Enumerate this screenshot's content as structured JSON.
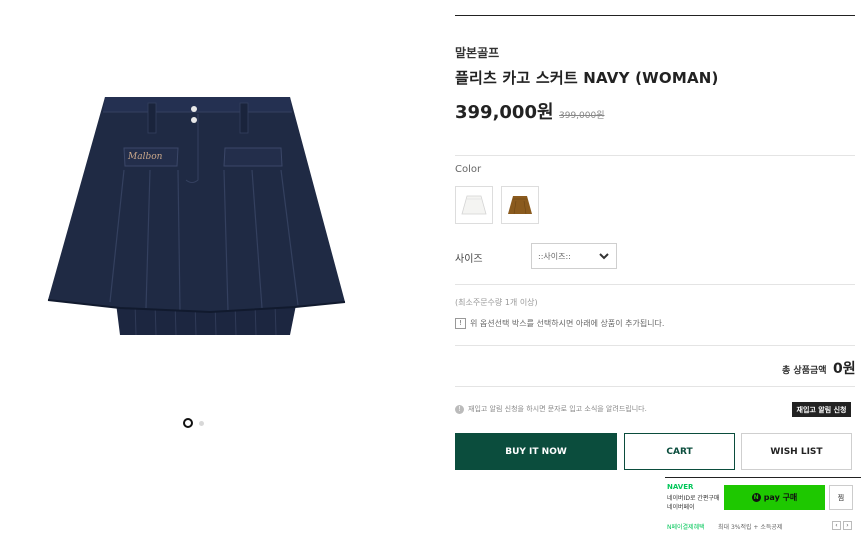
{
  "product": {
    "brand": "말본골프",
    "title": "플리츠 카고 스커트 NAVY (WOMAN)",
    "price": "399,000원",
    "original_price": "399,000원",
    "image_icon": "skirt-photo",
    "skirt_logo_text": "Malbon"
  },
  "options": {
    "color_label": "Color",
    "swatches": [
      {
        "name": "white",
        "color": "#f2f2f0"
      },
      {
        "name": "brown",
        "color": "#8a5a1e"
      }
    ],
    "size_label": "사이즈",
    "size_placeholder": "::사이즈::",
    "min_qty": "(최소주문수량 1개 이상)",
    "notice": "위 옵션선택 박스를 선택하시면 아래에 상품이 추가됩니다."
  },
  "total": {
    "label": "총 상품금액",
    "value": "0원"
  },
  "restock": {
    "info": "재입고 알림 신청을 하시면 문자로 입고 소식을 알려드립니다.",
    "button": "재입고 알림 신청"
  },
  "actions": {
    "buy_now": "BUY IT NOW",
    "cart": "CART",
    "wish": "WISH LIST"
  },
  "naver": {
    "logo": "NAVER",
    "sub1": "네이버ID로 간편구매",
    "sub2": "네이버페이",
    "pay_button": "pay 구매",
    "jjim": "찜",
    "benefit_label": "N페이결제혜택",
    "benefit_text": "최대 3%적립 + 소득공제"
  },
  "gallery": {
    "dot_count": 2,
    "active_index": 0
  },
  "colors": {
    "accent": "#0b4d3d",
    "naver_green": "#1ec800",
    "skirt_navy": "#1f2a44"
  }
}
